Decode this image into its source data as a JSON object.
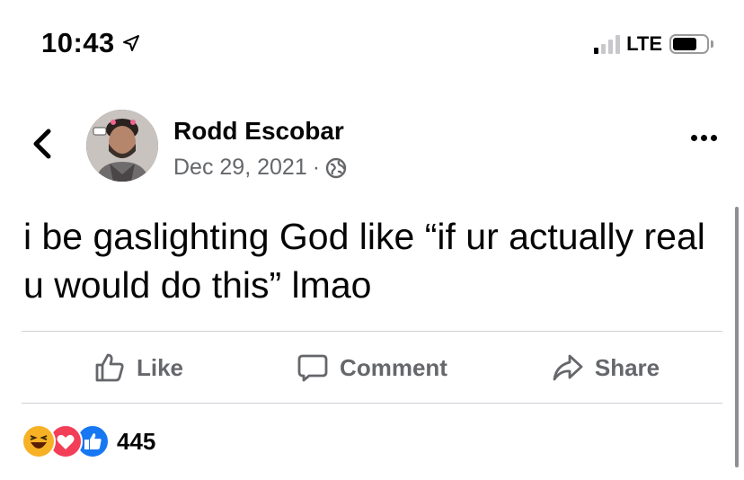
{
  "status_bar": {
    "time": "10:43",
    "network": "LTE",
    "signal_bars_active": 1,
    "battery_level": 0.72
  },
  "post": {
    "author": "Rodd Escobar",
    "date": "Dec 29, 2021",
    "separator": "·",
    "text": "i be gaslighting God like “if ur actually real u would do this” lmao",
    "reaction_count": "445"
  },
  "actions": {
    "like_label": "Like",
    "comment_label": "Comment",
    "share_label": "Share"
  },
  "icons": {
    "back": "chevron-left-icon",
    "more": "more-options-icon",
    "privacy": "globe-icon",
    "location": "location-arrow-icon"
  },
  "colors": {
    "text_primary": "#050505",
    "text_secondary": "#65676b",
    "divider": "#ced0d4",
    "like_blue": "#1877f2",
    "love_red": "#f33e58",
    "haha_yellow": "#f7b125"
  }
}
